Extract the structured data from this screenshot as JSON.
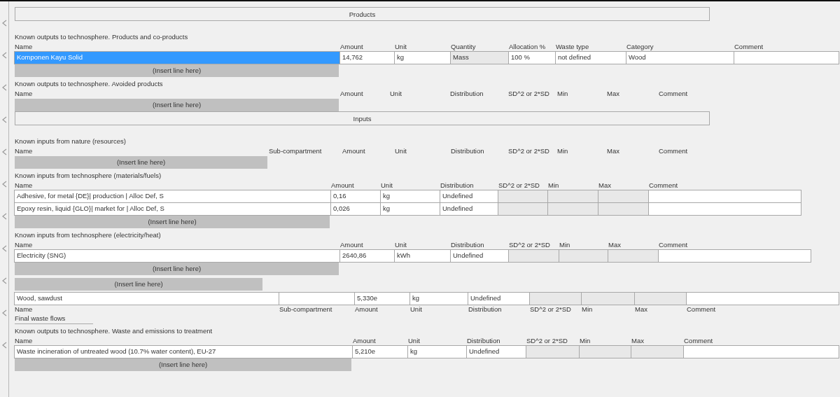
{
  "sections": [
    {
      "kind": "bar",
      "label": "Products"
    },
    {
      "kind": "table",
      "title": "Known outputs to technosphere. Products and co-products",
      "flipped": false,
      "insert": "(Insert line here)",
      "columns": [
        {
          "label": "Name",
          "kind": "text"
        },
        {
          "label": "Amount",
          "kind": "text"
        },
        {
          "label": "Unit",
          "kind": "text"
        },
        {
          "label": "Quantity",
          "kind": "readonly"
        },
        {
          "label": "Allocation %",
          "kind": "text"
        },
        {
          "label": "Waste type",
          "kind": "text"
        },
        {
          "label": "Category",
          "kind": "text"
        },
        {
          "label": "Comment",
          "kind": "text"
        }
      ],
      "rows": [
        {
          "selected": true,
          "cells": [
            "Komponen Kayu Solid",
            "14,762",
            "kg",
            "Mass",
            "100 %",
            "not defined",
            "Wood",
            null
          ]
        }
      ]
    },
    {
      "kind": "table",
      "title": "Known outputs to technosphere. Avoided products",
      "flipped": false,
      "insert": "(Insert line here)",
      "columns": [
        {
          "label": "Name"
        },
        {
          "label": "Amount"
        },
        {
          "label": "Unit"
        },
        {
          "label": "Distribution"
        },
        {
          "label": "SD^2 or 2*SD"
        },
        {
          "label": "Min"
        },
        {
          "label": "Max"
        },
        {
          "label": "Comment"
        }
      ]
    },
    {
      "kind": "bar",
      "label": "Inputs"
    },
    {
      "kind": "table",
      "title": "Known inputs from nature (resources)",
      "flipped": false,
      "insert": "(Insert line here)",
      "columns": [
        {
          "label": "Name"
        },
        {
          "label": "Sub-compartment"
        },
        {
          "label": "Amount"
        },
        {
          "label": "Unit"
        },
        {
          "label": "Distribution"
        },
        {
          "label": "SD^2 or 2*SD"
        },
        {
          "label": "Min"
        },
        {
          "label": "Max"
        },
        {
          "label": "Comment"
        }
      ]
    },
    {
      "kind": "table",
      "title": "Known inputs from technosphere (materials/fuels)",
      "flipped": false,
      "insert": "(Insert line here)",
      "columns": [
        {
          "label": "Name",
          "kind": "text"
        },
        {
          "label": "Amount",
          "kind": "text"
        },
        {
          "label": "Unit",
          "kind": "text"
        },
        {
          "label": "Distribution",
          "kind": "text"
        },
        {
          "label": "SD^2 or 2*SD",
          "kind": "readonly"
        },
        {
          "label": "Min",
          "kind": "readonly"
        },
        {
          "label": "Max",
          "kind": "readonly"
        },
        {
          "label": "Comment",
          "kind": "text"
        }
      ],
      "rows": [
        {
          "selected": false,
          "cells": [
            "Adhesive, for metal {DE}| production | Alloc Def, S",
            "0,16",
            "kg",
            "Undefined",
            null,
            null,
            null,
            null
          ]
        },
        {
          "selected": false,
          "cells": [
            "Epoxy resin, liquid {GLO}| market for | Alloc Def, S",
            "0,026",
            "kg",
            "Undefined",
            null,
            null,
            null,
            null
          ]
        }
      ]
    },
    {
      "kind": "table",
      "title": "Known inputs from technosphere (electricity/heat)",
      "flipped": false,
      "insert": "(Insert line here)",
      "columns": [
        {
          "label": "Name",
          "kind": "text"
        },
        {
          "label": "Amount",
          "kind": "text"
        },
        {
          "label": "Unit",
          "kind": "text"
        },
        {
          "label": "Distribution",
          "kind": "text"
        },
        {
          "label": "SD^2 or 2*SD",
          "kind": "readonly"
        },
        {
          "label": "Min",
          "kind": "readonly"
        },
        {
          "label": "Max",
          "kind": "readonly"
        },
        {
          "label": "Comment",
          "kind": "text"
        }
      ],
      "rows": [
        {
          "selected": false,
          "cells": [
            "Electricity (SNG)",
            "2640,86",
            "kWh",
            "Undefined",
            null,
            null,
            null,
            null
          ]
        }
      ]
    },
    {
      "kind": "stack",
      "lines": [
        {
          "kind": "insert",
          "text": "(Insert line here)"
        },
        {
          "kind": "entry",
          "cells": [
            {
              "kind": "text",
              "text": "Wood, sawdust"
            },
            {
              "kind": "text"
            },
            {
              "kind": "text",
              "text": "5,330e"
            },
            {
              "kind": "text",
              "text": "kg"
            },
            {
              "kind": "text",
              "text": "Undefined"
            },
            {
              "kind": "readonly"
            },
            {
              "kind": "readonly"
            },
            {
              "kind": "readonly"
            },
            {
              "kind": "text"
            }
          ]
        },
        {
          "kind": "labels",
          "values": [
            "Name",
            "Sub-compartment",
            "Amount",
            "Unit",
            "Distribution",
            "SD^2 or 2*SD",
            "Min",
            "Max",
            "Comment"
          ]
        },
        {
          "kind": "caption",
          "text": "Final waste flows"
        }
      ]
    },
    {
      "kind": "table",
      "title": "Known outputs to technosphere. Waste and emissions to treatment",
      "flipped": false,
      "insert": "(Insert line here)",
      "columns": [
        {
          "label": "Name",
          "kind": "text"
        },
        {
          "label": "Amount",
          "kind": "text"
        },
        {
          "label": "Unit",
          "kind": "text"
        },
        {
          "label": "Distribution",
          "kind": "text"
        },
        {
          "label": "SD^2 or 2*SD",
          "kind": "readonly"
        },
        {
          "label": "Min",
          "kind": "readonly"
        },
        {
          "label": "Max",
          "kind": "readonly"
        },
        {
          "label": "Comment",
          "kind": "text"
        }
      ],
      "rows": [
        {
          "selected": false,
          "cells": [
            "Waste incineration of untreated wood (10.7% water content), EU-27",
            "5,210e",
            "kg",
            "Undefined",
            null,
            null,
            null,
            null
          ]
        }
      ]
    }
  ]
}
